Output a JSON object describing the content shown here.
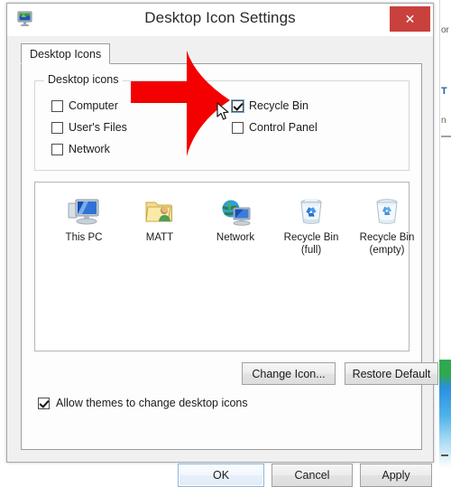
{
  "window": {
    "title": "Desktop Icon Settings",
    "icon_name": "display-settings-icon",
    "close_label": "✕"
  },
  "tabs": [
    {
      "label": "Desktop Icons",
      "selected": true
    }
  ],
  "group": {
    "legend": "Desktop icons",
    "checkboxes": [
      {
        "label": "Computer",
        "checked": false,
        "focused": false
      },
      {
        "label": "User's Files",
        "checked": false,
        "focused": false
      },
      {
        "label": "Network",
        "checked": false,
        "focused": false
      },
      {
        "label": "Recycle Bin",
        "checked": true,
        "focused": true
      },
      {
        "label": "Control Panel",
        "checked": false,
        "focused": false
      }
    ]
  },
  "preview": {
    "items": [
      {
        "caption": "This PC",
        "icon": "computer-monitor-icon"
      },
      {
        "caption": "MATT",
        "icon": "user-folder-icon"
      },
      {
        "caption": "Network",
        "icon": "network-globe-icon"
      },
      {
        "caption": "Recycle Bin\n(full)",
        "icon": "recycle-bin-full-icon"
      },
      {
        "caption": "Recycle Bin\n(empty)",
        "icon": "recycle-bin-empty-icon"
      }
    ]
  },
  "actions": {
    "change_icon": "Change Icon...",
    "restore_default": "Restore Default"
  },
  "allow_themes": {
    "label": "Allow themes to change desktop icons",
    "checked": true
  },
  "footer": {
    "ok": "OK",
    "cancel": "Cancel",
    "apply": "Apply"
  },
  "annotation": {
    "arrow_color": "#f40000",
    "arrow_name": "red-pointer-arrow",
    "cursor_name": "mouse-pointer-cursor"
  },
  "background": {
    "text_a": "or",
    "text_b": "T",
    "text_c": "n",
    "wallpaper_colors": [
      "#2fa84f",
      "#2a8fe0",
      "#9fd6f2"
    ]
  },
  "colors": {
    "close_red": "#c9413c",
    "dialog_bg": "#f0f0f0",
    "tab_page_bg": "#fdfdfd",
    "accent_blue": "#8ab4e0"
  }
}
